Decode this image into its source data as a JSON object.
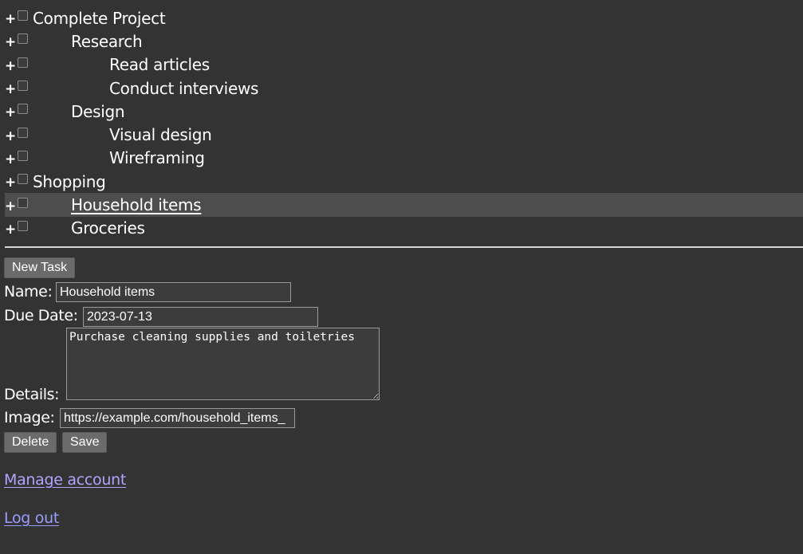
{
  "tree": {
    "items": [
      {
        "label": "Complete Project",
        "level": 0,
        "expander": "+",
        "selected": false
      },
      {
        "label": "Research",
        "level": 1,
        "expander": "+",
        "selected": false
      },
      {
        "label": "Read articles",
        "level": 2,
        "expander": "+",
        "selected": false
      },
      {
        "label": "Conduct interviews",
        "level": 2,
        "expander": "+",
        "selected": false
      },
      {
        "label": "Design",
        "level": 1,
        "expander": "+",
        "selected": false
      },
      {
        "label": "Visual design",
        "level": 2,
        "expander": "+",
        "selected": false
      },
      {
        "label": "Wireframing",
        "level": 2,
        "expander": "+",
        "selected": false
      },
      {
        "label": "Shopping",
        "level": 0,
        "expander": "+",
        "selected": false
      },
      {
        "label": "Household items",
        "level": 1,
        "expander": "+",
        "selected": true
      },
      {
        "label": "Groceries",
        "level": 1,
        "expander": "+",
        "selected": false
      }
    ]
  },
  "toolbar": {
    "new_task_label": "New Task"
  },
  "form": {
    "name_label": "Name:",
    "name_value": "Household items",
    "due_date_label": "Due Date:",
    "due_date_value": "2023-07-13",
    "details_label": "Details:",
    "details_value": "Purchase cleaning supplies and toiletries",
    "image_label": "Image:",
    "image_value": "https://example.com/household_items_",
    "delete_label": "Delete",
    "save_label": "Save"
  },
  "links": {
    "manage_account": "Manage account",
    "log_out": "Log out"
  },
  "colors": {
    "background": "#333333",
    "selected_row": "#4d4d4d",
    "button": "#6b6b6b",
    "link_manage": "#b3a3ff",
    "link_logout": "#9a9cff"
  }
}
